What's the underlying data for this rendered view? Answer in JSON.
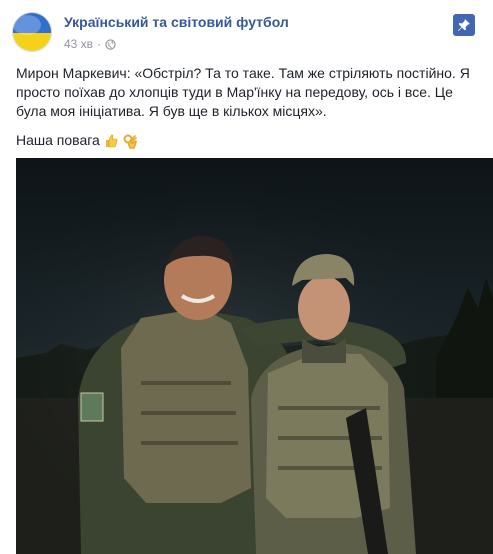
{
  "post": {
    "page_name": "Український та світовий футбол",
    "time": "43 хв",
    "paragraph": "Мирон Маркевич: «Обстріл? Та то таке. Там же стріляють постійно. Я просто поїхав до хлопців туди в Мар'їнку на передову, ось і все. Це була моя ініціатива. Я був ще в кількох місцях».",
    "respect_text": "Наша повага",
    "emojis": [
      "thumbs-up-icon",
      "ok-hand-icon"
    ]
  },
  "icons": {
    "avatar": "ukraine-flag-avatar",
    "privacy": "globe-icon",
    "pin": "pin-icon"
  },
  "colors": {
    "link": "#365899",
    "meta": "#90949c",
    "pin_button": "#4267b2",
    "flag_blue": "#2f6fd0",
    "flag_yellow": "#f5d21a"
  }
}
